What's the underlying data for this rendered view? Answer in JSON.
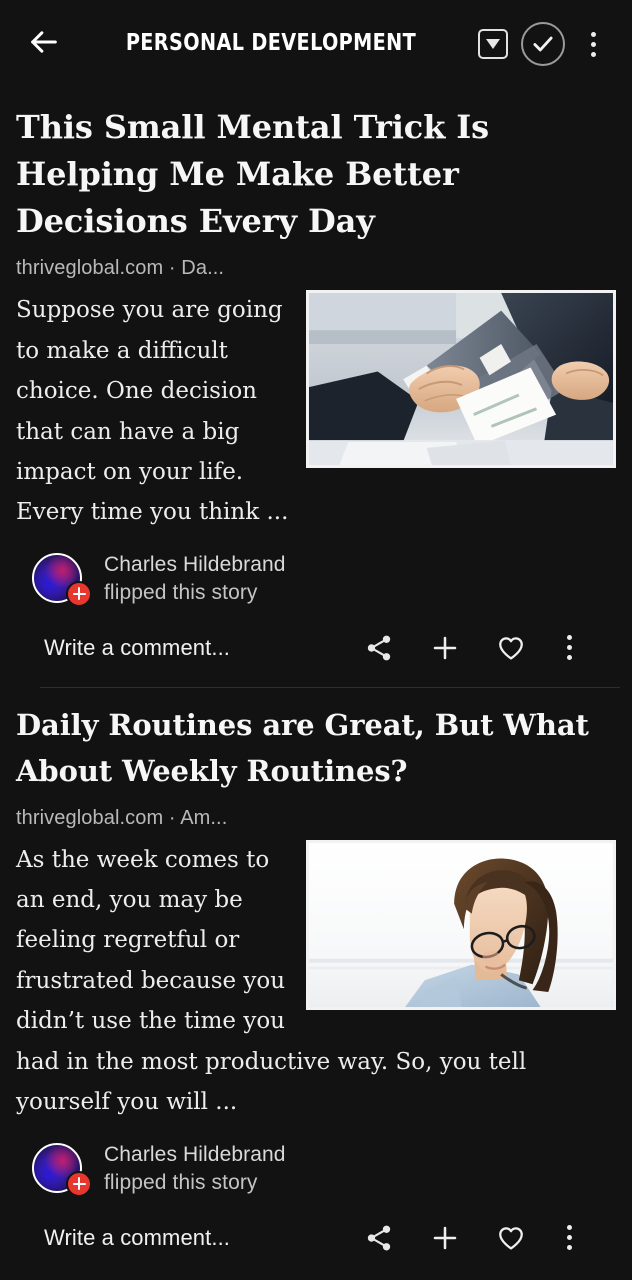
{
  "header": {
    "back_icon": "back-arrow-icon",
    "title": "PERSONAL DEVELOPMENT",
    "dropdown_icon": "dropdown-box-icon",
    "check_icon": "check-circle-icon",
    "menu_icon": "overflow-menu-icon"
  },
  "articles": [
    {
      "headline": "This Small Mental Trick Is Helping Me Make Better Decisions Every Day",
      "source": "thriveglobal.com · Da...",
      "excerpt": "Suppose you are going to make a difficult choice. One decision that can have a big impact on your life. Every time you think ...",
      "image_alt": "business-handshake-photo",
      "attribution": {
        "name": "Charles Hildebrand",
        "action": "flipped this story",
        "avatar_badge": "add-plus-badge"
      },
      "actions": {
        "comment_placeholder": "Write a comment...",
        "share_icon": "share-icon",
        "add_icon": "plus-icon",
        "like_icon": "heart-icon",
        "more_icon": "overflow-menu-icon"
      }
    },
    {
      "headline": "Daily Routines are Great, But What About Weekly Routines?",
      "source": "thriveglobal.com · Am...",
      "excerpt": "As the week comes to an end, you may be feeling regretful or frustrated because you didn’t use the time you had in the most productive way. So, you tell yourself you will ...",
      "image_alt": "woman-with-glasses-looking-down-photo",
      "attribution": {
        "name": "Charles Hildebrand",
        "action": "flipped this story",
        "avatar_badge": "add-plus-badge"
      },
      "actions": {
        "comment_placeholder": "Write a comment...",
        "share_icon": "share-icon",
        "add_icon": "plus-icon",
        "like_icon": "heart-icon",
        "more_icon": "overflow-menu-icon"
      }
    }
  ],
  "colors": {
    "background": "#121212",
    "text_primary": "#f6f6f6",
    "text_secondary": "#b9b9b9",
    "badge_red": "#e8372e",
    "divider": "#2e2e2e"
  }
}
